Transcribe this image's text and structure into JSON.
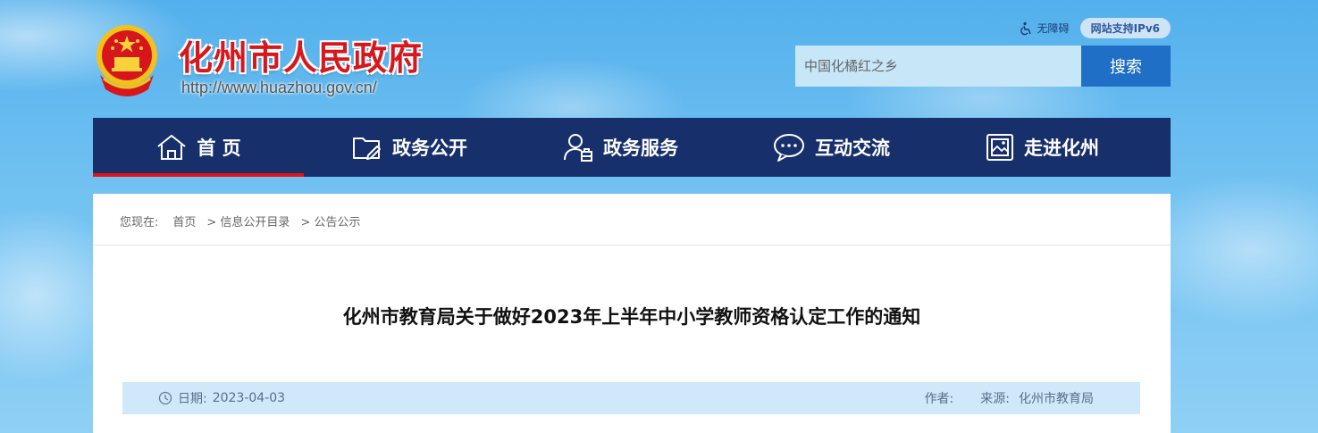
{
  "header": {
    "site_title": "化州市人民政府",
    "site_url": "http://www.huazhou.gov.cn/",
    "accessibility_label": "无障碍",
    "ipv6_badge": "网站支持IPv6"
  },
  "search": {
    "placeholder": "中国化橘红之乡",
    "button_label": "搜索"
  },
  "nav": {
    "items": [
      {
        "label": "首 页",
        "icon": "home-icon"
      },
      {
        "label": "政务公开",
        "icon": "folder-edit-icon"
      },
      {
        "label": "政务服务",
        "icon": "user-service-icon"
      },
      {
        "label": "互动交流",
        "icon": "chat-bubble-icon"
      },
      {
        "label": "走进化州",
        "icon": "picture-frame-icon"
      }
    ],
    "active_index": 0,
    "active_color": "#e1121b",
    "background_color": "#17306b"
  },
  "breadcrumb": {
    "prefix": "您现在:",
    "items": [
      "首页",
      "> 信息公开目录",
      "> 公告公示"
    ]
  },
  "article": {
    "title": "化州市教育局关于做好2023年上半年中小学教师资格认定工作的通知",
    "date_label": "日期:",
    "date": "2023-04-03",
    "author_label": "作者:",
    "source_label": "来源:",
    "source": "化州市教育局"
  },
  "colors": {
    "brand_red": "#d8171d",
    "search_button": "#1f6fc6"
  }
}
